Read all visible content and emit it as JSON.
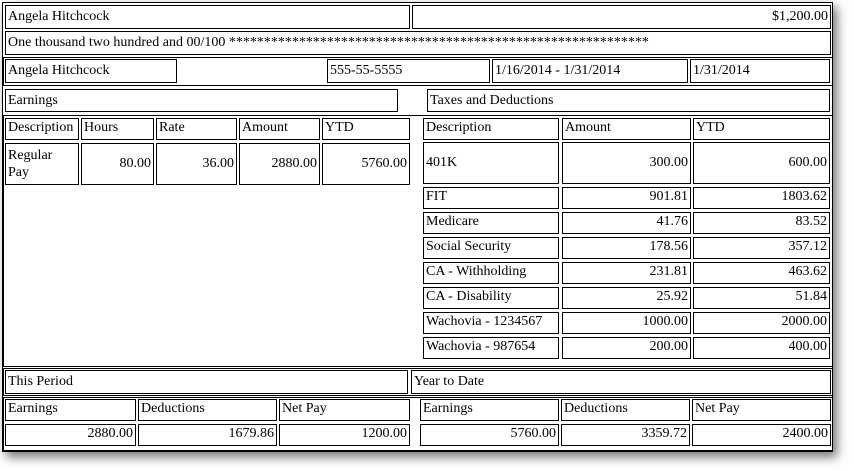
{
  "check": {
    "payee": "Angela Hitchcock",
    "amount": "$1,200.00",
    "amount_words": "One thousand two hundred and 00/100 ************************************************************"
  },
  "employee": {
    "name": "Angela Hitchcock",
    "ssn": "555-55-5555",
    "pay_period": "1/16/2014 - 1/31/2014",
    "pay_date": "1/31/2014"
  },
  "earnings": {
    "title": "Earnings",
    "headers": [
      "Description",
      "Hours",
      "Rate",
      "Amount",
      "YTD"
    ],
    "rows": [
      [
        "Regular Pay",
        "80.00",
        "36.00",
        "2880.00",
        "5760.00"
      ]
    ]
  },
  "deductions": {
    "title": "Taxes and Deductions",
    "headers": [
      "Description",
      "Amount",
      "YTD"
    ],
    "rows": [
      [
        "401K",
        "300.00",
        "600.00"
      ],
      [
        "FIT",
        "901.81",
        "1803.62"
      ],
      [
        "Medicare",
        "41.76",
        "83.52"
      ],
      [
        "Social Security",
        "178.56",
        "357.12"
      ],
      [
        "CA - Withholding",
        "231.81",
        "463.62"
      ],
      [
        "CA - Disability",
        "25.92",
        "51.84"
      ],
      [
        "Wachovia - 1234567",
        "1000.00",
        "2000.00"
      ],
      [
        "Wachovia - 987654",
        "200.00",
        "400.00"
      ]
    ]
  },
  "summary": {
    "this_period": {
      "title": "This Period",
      "headers": [
        "Earnings",
        "Deductions",
        "Net Pay"
      ],
      "values": [
        "2880.00",
        "1679.86",
        "1200.00"
      ]
    },
    "year_to_date": {
      "title": "Year to Date",
      "headers": [
        "Earnings",
        "Deductions",
        "Net Pay"
      ],
      "values": [
        "5760.00",
        "3359.72",
        "2400.00"
      ]
    }
  }
}
